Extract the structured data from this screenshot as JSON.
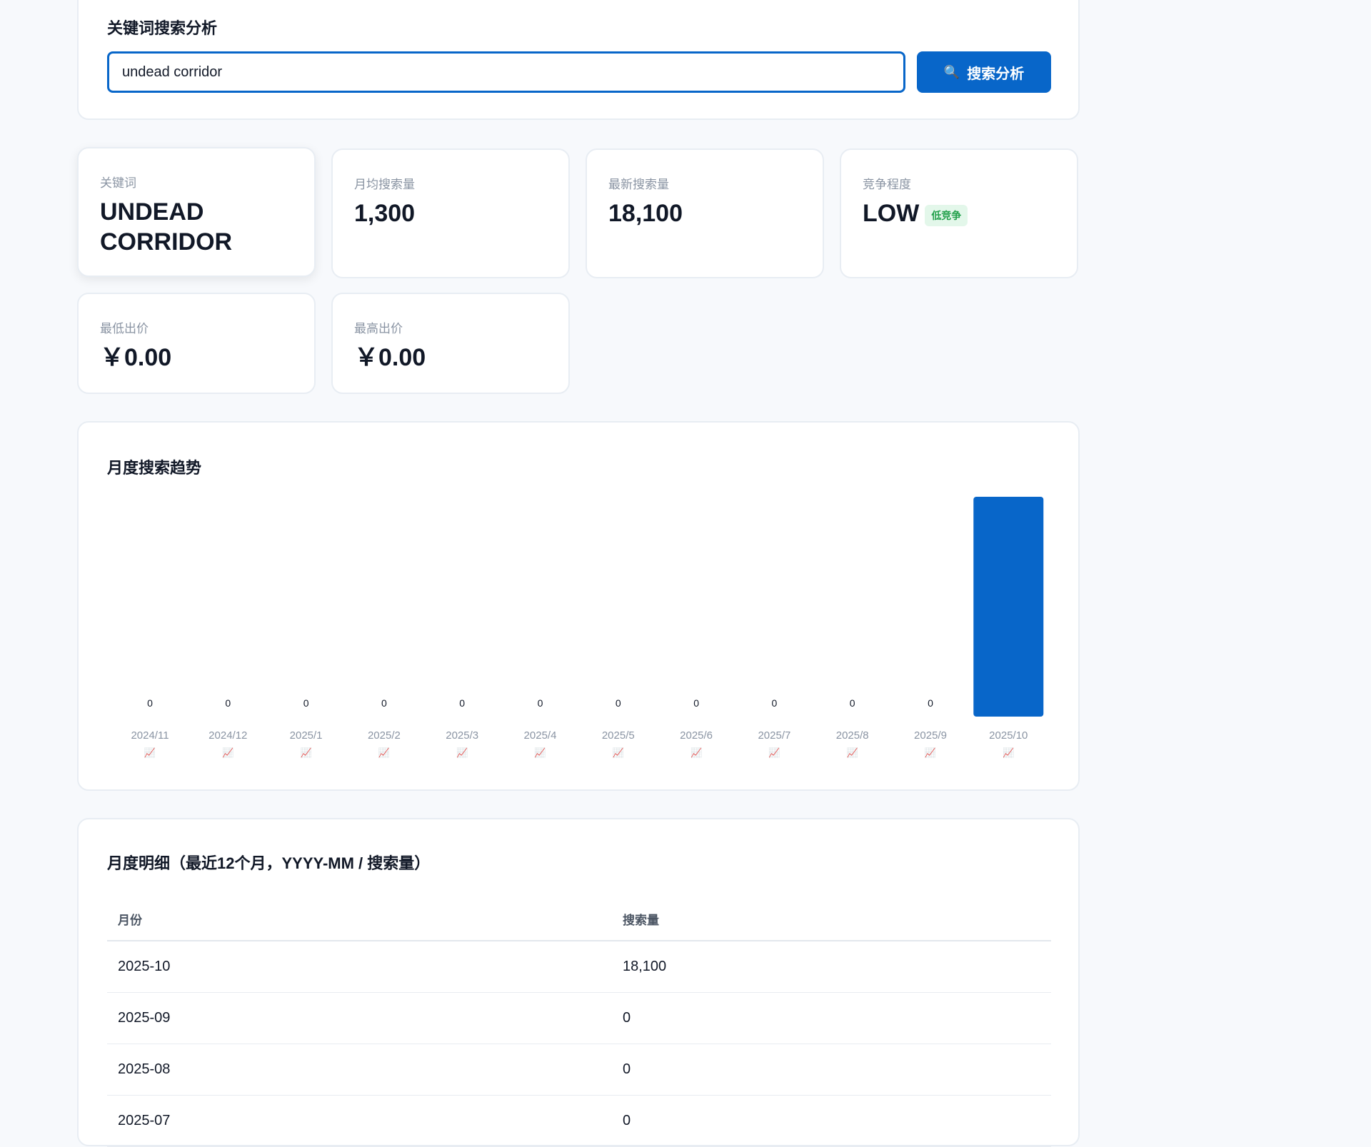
{
  "search": {
    "title": "关键词搜索分析",
    "input_value": "undead corridor",
    "button_icon": "search-icon",
    "button_label": "搜索分析"
  },
  "stats": {
    "keyword": {
      "label": "关键词",
      "value": "UNDEAD CORRIDOR"
    },
    "monthly_avg": {
      "label": "月均搜索量",
      "value": "1,300"
    },
    "latest": {
      "label": "最新搜索量",
      "value": "18,100"
    },
    "competition": {
      "label": "竞争程度",
      "value": "LOW",
      "badge": "低竞争",
      "badge_color": "#22a04b"
    },
    "min_bid": {
      "label": "最低出价",
      "value": "￥0.00"
    },
    "max_bid": {
      "label": "最高出价",
      "value": "￥0.00"
    }
  },
  "chart_data": {
    "type": "bar",
    "title": "月度搜索趋势",
    "categories": [
      "2024/11",
      "2024/12",
      "2025/1",
      "2025/2",
      "2025/3",
      "2025/4",
      "2025/5",
      "2025/6",
      "2025/7",
      "2025/8",
      "2025/9",
      "2025/10"
    ],
    "values": [
      0,
      0,
      0,
      0,
      0,
      0,
      0,
      0,
      0,
      0,
      0,
      18100
    ],
    "show_value_labels_for_zero": true,
    "tick_icon": "📈",
    "bar_color": "#0866c9",
    "xlabel": "",
    "ylabel": ""
  },
  "table": {
    "title": "月度明细（最近12个月，YYYY-MM / 搜索量）",
    "headers": [
      "月份",
      "搜索量"
    ],
    "rows": [
      [
        "2025-10",
        "18,100"
      ],
      [
        "2025-09",
        "0"
      ],
      [
        "2025-08",
        "0"
      ],
      [
        "2025-07",
        "0"
      ]
    ]
  },
  "colors": {
    "accent": "#0866c9",
    "background": "#f7f9fc"
  }
}
